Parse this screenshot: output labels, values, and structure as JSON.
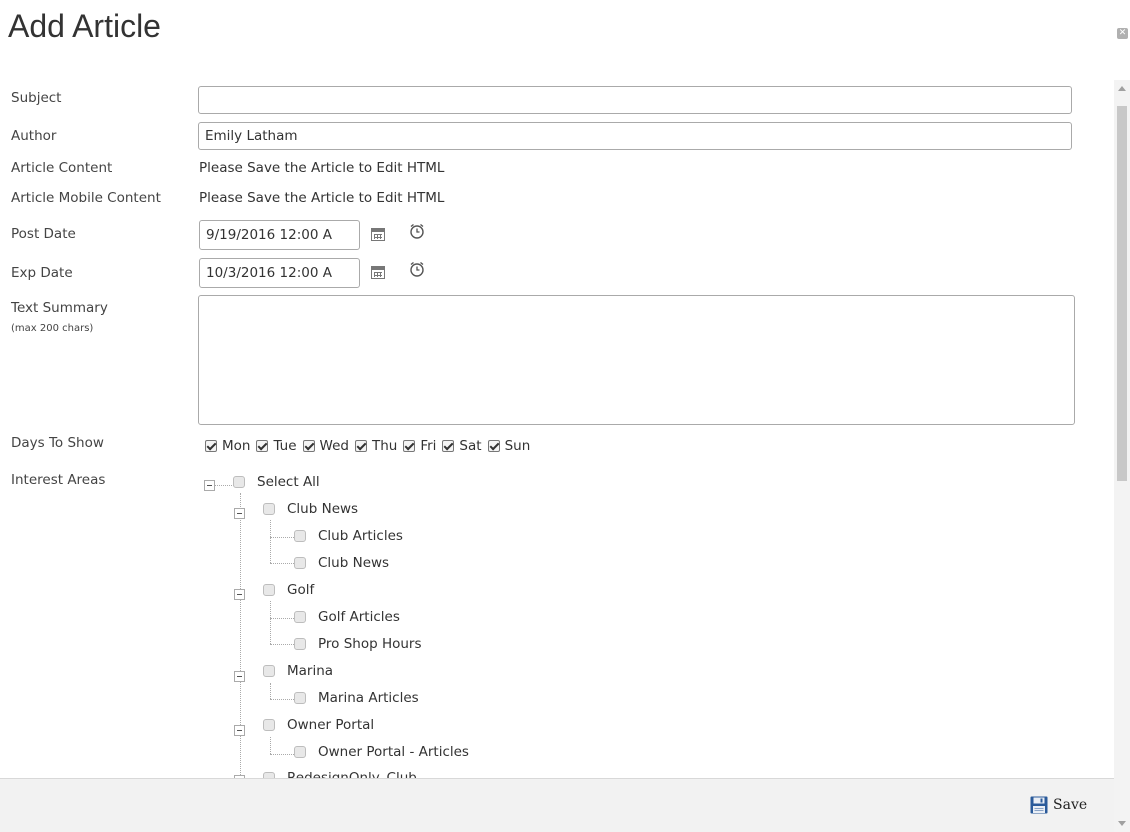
{
  "dialog": {
    "title": "Add Article",
    "close_symbol": "✕"
  },
  "form": {
    "subject": {
      "label": "Subject",
      "value": ""
    },
    "author": {
      "label": "Author",
      "value": "Emily Latham"
    },
    "article_content": {
      "label": "Article Content",
      "value": "Please Save the Article to Edit HTML"
    },
    "article_mobile_content": {
      "label": "Article Mobile Content",
      "value": "Please Save the Article to Edit HTML"
    },
    "post_date": {
      "label": "Post Date",
      "value": "9/19/2016 12:00 A"
    },
    "exp_date": {
      "label": "Exp Date",
      "value": "10/3/2016 12:00 A"
    },
    "text_summary": {
      "label": "Text Summary",
      "sublabel": "(max 200 chars)",
      "value": ""
    },
    "days_to_show": {
      "label": "Days To Show",
      "days": [
        {
          "label": "Mon",
          "checked": true
        },
        {
          "label": "Tue",
          "checked": true
        },
        {
          "label": "Wed",
          "checked": true
        },
        {
          "label": "Thu",
          "checked": true
        },
        {
          "label": "Fri",
          "checked": true
        },
        {
          "label": "Sat",
          "checked": true
        },
        {
          "label": "Sun",
          "checked": true
        }
      ]
    },
    "interest_areas": {
      "label": "Interest Areas",
      "select_all": "Select All",
      "groups": [
        {
          "label": "Club News",
          "children": [
            "Club Articles",
            "Club News"
          ]
        },
        {
          "label": "Golf",
          "children": [
            "Golf Articles",
            "Pro Shop Hours"
          ]
        },
        {
          "label": "Marina",
          "children": [
            "Marina Articles"
          ]
        },
        {
          "label": "Owner Portal",
          "children": [
            "Owner Portal - Articles"
          ]
        },
        {
          "label": "RedesignOnly_Club",
          "children": []
        }
      ]
    }
  },
  "footer": {
    "save_label": "Save"
  },
  "icons": {
    "calendar": "calendar-icon",
    "clock": "clock-icon",
    "save": "floppy-disk-icon",
    "close": "close-icon"
  },
  "colors": {
    "save_icon": "#2a5a9a",
    "footer_bg": "#f2f2f2"
  }
}
